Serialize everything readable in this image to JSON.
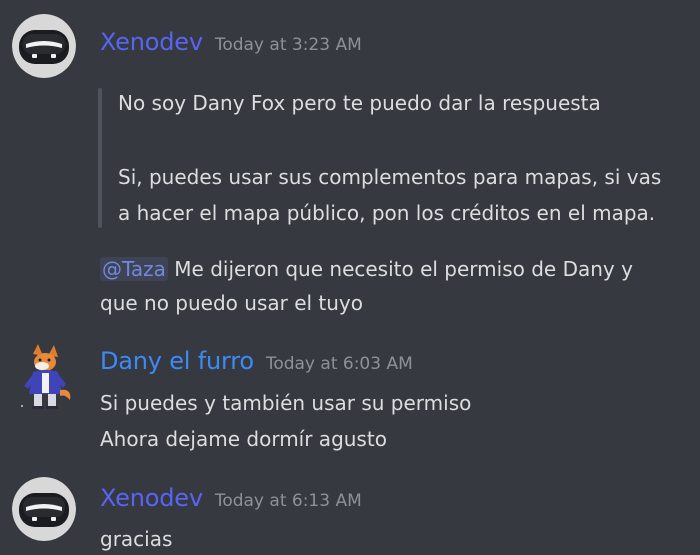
{
  "colors": {
    "background": "#36393f",
    "xenodev_name": "#5865f2",
    "dany_name": "#3d8af7",
    "text": "#dcddde",
    "timestamp": "#8e9297",
    "mention": "#7289da"
  },
  "messages": [
    {
      "author": "Xenodev",
      "timestamp": "Today at 3:23 AM",
      "avatar_icon": "helmet-avatar-icon",
      "quote": {
        "line1": "No soy Dany Fox pero te puedo dar la respuesta",
        "line2": "Si, puedes usar sus complementos para mapas, si vas",
        "line3": "a hacer el mapa público, pon los créditos en el mapa."
      },
      "mention": "@Taza",
      "line1_text": " Me dijeron que necesito el permiso de Dany y",
      "line2_text": "que no puedo usar el tuyo"
    },
    {
      "author": "Dany el furro",
      "timestamp": "Today at 6:03 AM",
      "avatar_icon": "fox-character-avatar-icon",
      "line1": "Si puedes y también usar su permiso",
      "line2": "Ahora dejame dormír agusto"
    },
    {
      "author": "Xenodev",
      "timestamp": "Today at 6:13 AM",
      "avatar_icon": "helmet-avatar-icon",
      "line1": "gracias"
    }
  ]
}
